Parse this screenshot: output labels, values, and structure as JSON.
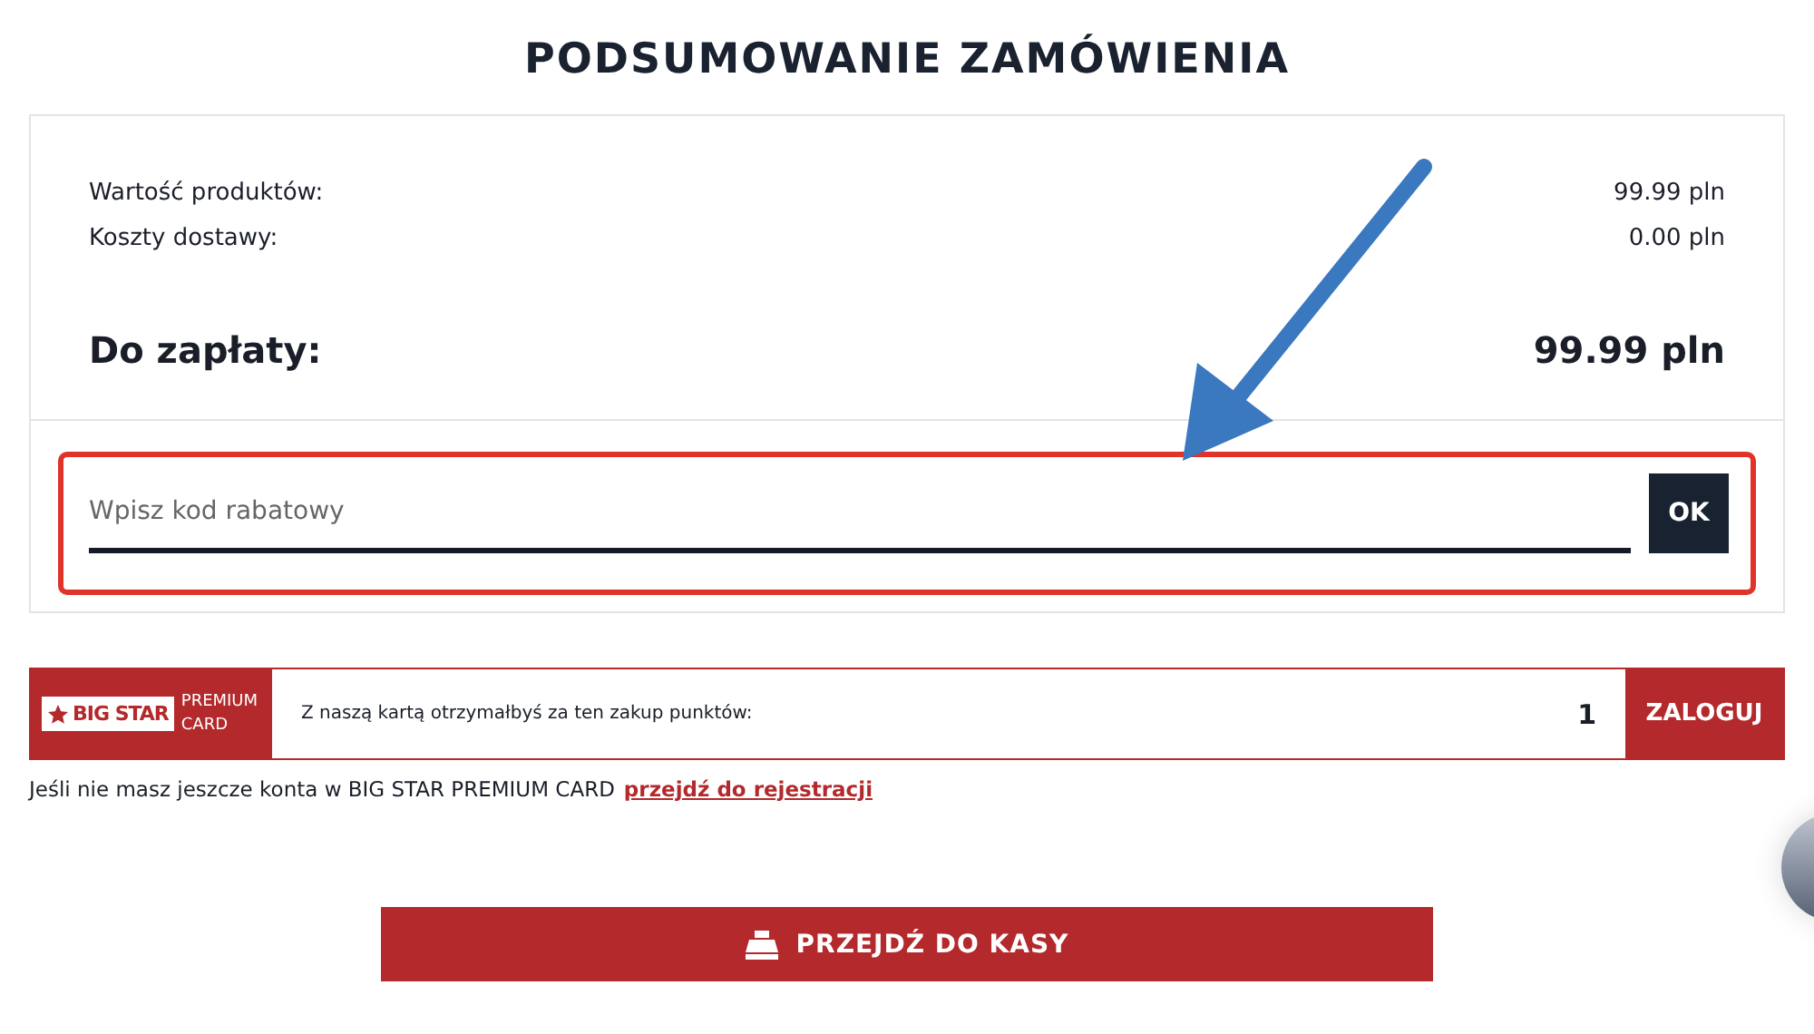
{
  "title": "PODSUMOWANIE ZAMÓWIENIA",
  "summary": {
    "rows": [
      {
        "label": "Wartość produktów:",
        "value": "99.99 pln"
      },
      {
        "label": "Koszty dostawy:",
        "value": "0.00 pln"
      }
    ],
    "total": {
      "label": "Do zapłaty:",
      "value": "99.99 pln"
    }
  },
  "coupon": {
    "placeholder": "Wpisz kod rabatowy",
    "button": "OK"
  },
  "premium": {
    "logo": "BIG STAR",
    "logo_sub": "PREMIUM CARD",
    "text": "Z naszą kartą otrzymałbyś za ten zakup punktów:",
    "points": "1",
    "button": "ZALOGUJ"
  },
  "register": {
    "text": "Jeśli nie masz jeszcze konta w BIG STAR PREMIUM CARD",
    "link": "przejdź do rejestracji"
  },
  "checkout": {
    "label": "PRZEJDŹ DO KASY"
  }
}
